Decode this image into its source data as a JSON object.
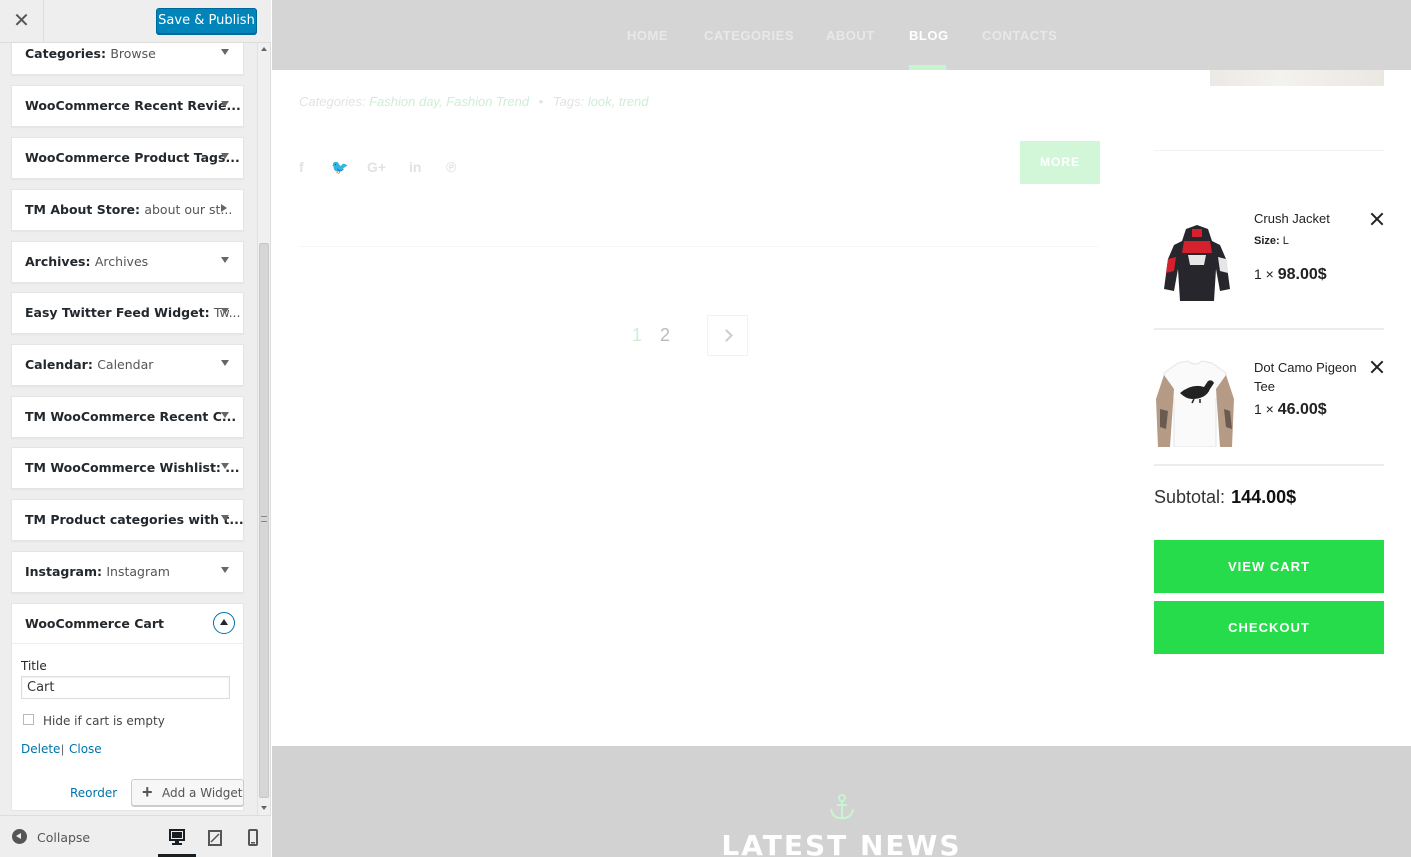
{
  "customizer": {
    "save_label": "Save & Publish",
    "widgets": [
      {
        "name": "Categories",
        "sub": "Browse"
      },
      {
        "name": "WooCommerce Recent Revie...",
        "sub": ""
      },
      {
        "name": "WooCommerce Product Tags...",
        "sub": ""
      },
      {
        "name": "TM About Store",
        "sub": "about our st..."
      },
      {
        "name": "Archives",
        "sub": "Archives"
      },
      {
        "name": "Easy Twitter Feed Widget",
        "sub": "Tw..."
      },
      {
        "name": "Calendar",
        "sub": "Calendar"
      },
      {
        "name": "TM WooCommerce Recent C...",
        "sub": ""
      },
      {
        "name": "TM WooCommerce Wishlist: ...",
        "sub": ""
      },
      {
        "name": "TM Product categories with t...",
        "sub": ""
      },
      {
        "name": "Instagram",
        "sub": "Instagram"
      }
    ],
    "open_widget": {
      "name": "WooCommerce Cart",
      "title_label": "Title",
      "title_value": "Cart",
      "hide_label": "Hide if cart is empty",
      "hide_checked": false,
      "delete_label": "Delete",
      "separator": "|",
      "close_label": "Close"
    },
    "reorder_label": "Reorder",
    "add_widget_label": "Add a Widget",
    "collapse_label": "Collapse",
    "active_device": "desktop"
  },
  "preview": {
    "nav": [
      {
        "label": "HOME",
        "active": false
      },
      {
        "label": "CATEGORIES",
        "active": false
      },
      {
        "label": "ABOUT",
        "active": false
      },
      {
        "label": "BLOG",
        "active": true
      },
      {
        "label": "CONTACTS",
        "active": false
      }
    ],
    "post_meta": {
      "categories_label": "Categories:",
      "categories": "Fashion day, Fashion Trend",
      "dot": "•",
      "tags_label": "Tags:",
      "tags": "look, trend"
    },
    "share_icons": [
      "facebook-icon",
      "twitter-icon",
      "google-plus-icon",
      "linkedin-icon",
      "pinterest-icon"
    ],
    "share_glyphs": [
      "f",
      "🐦",
      "G+",
      "in",
      "℗"
    ],
    "more_label": "MORE",
    "pagination": {
      "pages": [
        "1",
        "2"
      ],
      "current": "1"
    },
    "cart": {
      "items": [
        {
          "name": "Crush Jacket",
          "size_label": "Size:",
          "size": "L",
          "qty": "1 ×",
          "price": "98.00$"
        },
        {
          "name": "Dot Camo Pigeon Tee",
          "qty": "1 ×",
          "price": "46.00$"
        }
      ],
      "subtotal_label": "Subtotal:",
      "subtotal": "144.00$",
      "view_cart_label": "VIEW CART",
      "checkout_label": "CHECKOUT"
    },
    "news_title": "LATEST NEWS"
  },
  "colors": {
    "accent_green": "#27dc4a",
    "wp_blue": "#0085ba",
    "nav_bg": "#d5d5d5"
  }
}
